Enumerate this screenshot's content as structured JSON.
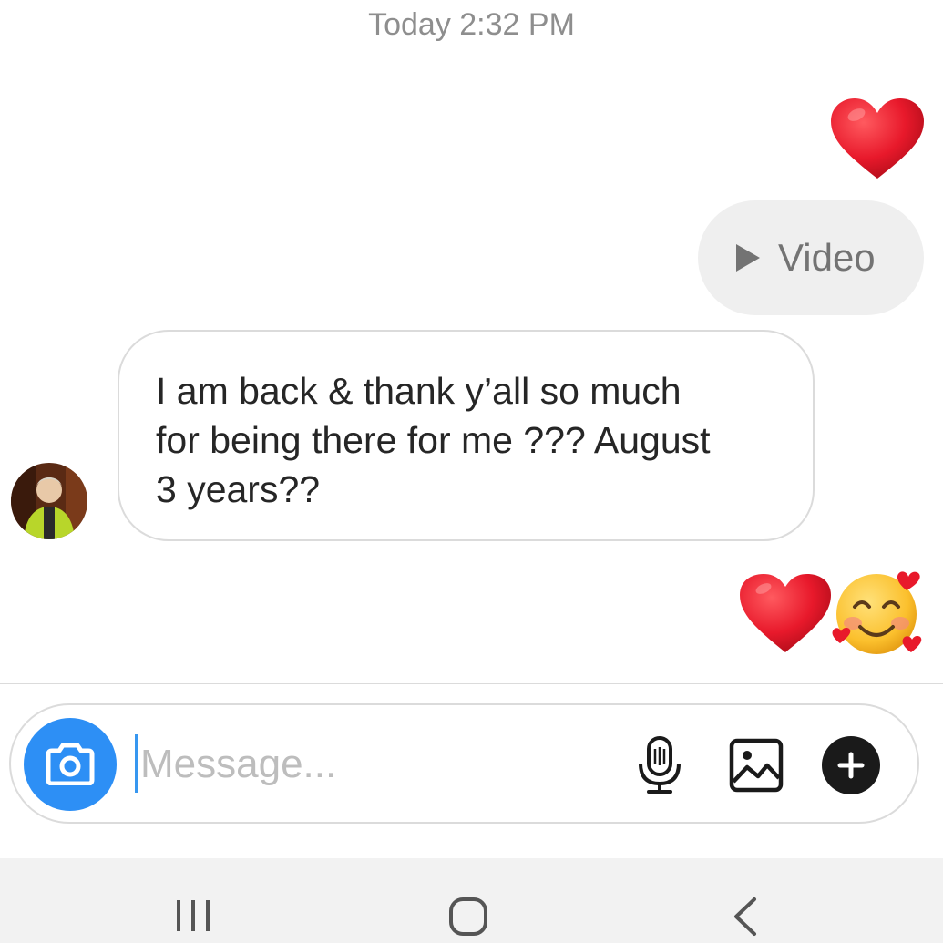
{
  "timestamp": "Today 2:32 PM",
  "outgoing_video": {
    "label": "Video",
    "icon": "play-icon"
  },
  "incoming_message": {
    "lines": [
      "I am back & thank y’all so much",
      "for being there for me ??? August",
      "3 years??"
    ]
  },
  "reactions": {
    "first": "heart-emoji",
    "second": [
      "heart-emoji",
      "smiling-face-with-hearts-emoji"
    ]
  },
  "composer": {
    "placeholder": "Message...",
    "value": "",
    "icons": [
      "camera-icon",
      "microphone-icon",
      "gallery-icon",
      "plus-icon"
    ]
  },
  "colors": {
    "accent_blue": "#2d8ff5",
    "heart_red": "#e8192b",
    "bubble_gray": "#efefef",
    "border_gray": "#dbdbdb"
  },
  "navbar": {
    "icons": [
      "recents-icon",
      "home-icon",
      "back-icon"
    ]
  }
}
